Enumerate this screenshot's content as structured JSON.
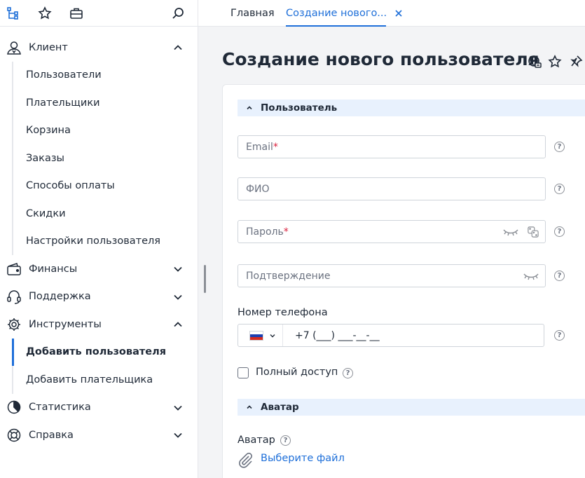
{
  "tabs": [
    {
      "label": "Главная"
    },
    {
      "label": "Создание нового..."
    }
  ],
  "sidebar": {
    "groups": [
      {
        "label": "Клиент",
        "icon": "user-icon",
        "expanded": true,
        "items": [
          "Пользователи",
          "Плательщики",
          "Корзина",
          "Заказы",
          "Способы оплаты",
          "Скидки",
          "Настройки пользователя"
        ]
      },
      {
        "label": "Финансы",
        "icon": "wallet-icon",
        "expanded": false
      },
      {
        "label": "Поддержка",
        "icon": "headset-icon",
        "expanded": false
      },
      {
        "label": "Инструменты",
        "icon": "gear-icon",
        "expanded": true,
        "items": [
          "Добавить пользователя",
          "Добавить плательщика"
        ],
        "active_item": "Добавить пользователя"
      },
      {
        "label": "Статистика",
        "icon": "pie-chart-icon",
        "expanded": false
      },
      {
        "label": "Справка",
        "icon": "lifebuoy-icon",
        "expanded": false
      }
    ]
  },
  "page": {
    "title": "Создание нового пользователя"
  },
  "form": {
    "section_user": "Пользователь",
    "email_placeholder": "Email",
    "fio_placeholder": "ФИО",
    "password_placeholder": "Пароль",
    "confirm_placeholder": "Подтверждение",
    "required_mark": "*",
    "phone_label": "Номер телефона",
    "phone_mask": "+7 (___) ___-__-__",
    "full_access_label": "Полный доступ",
    "section_avatar": "Аватар",
    "avatar_label": "Аватар",
    "choose_file": "Выберите файл",
    "help_mark": "?"
  },
  "colors": {
    "accent": "#1e6fd9",
    "required": "#d91e3c",
    "section_bg": "#e8f1fd"
  }
}
